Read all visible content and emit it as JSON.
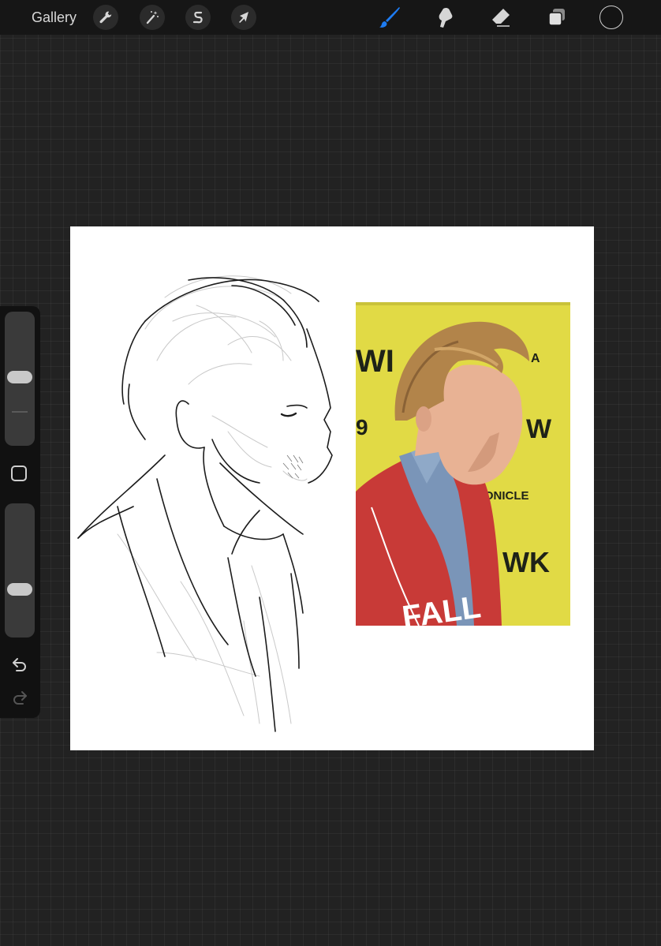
{
  "topbar": {
    "gallery_label": "Gallery",
    "left_tools": [
      {
        "name": "actions",
        "icon": "wrench-icon"
      },
      {
        "name": "adjustments",
        "icon": "magic-wand-icon"
      },
      {
        "name": "selection",
        "icon": "selection-s-icon"
      },
      {
        "name": "transform",
        "icon": "arrow-cursor-icon"
      }
    ],
    "right_tools": [
      {
        "name": "brush",
        "icon": "brush-icon",
        "active": true
      },
      {
        "name": "smudge",
        "icon": "smudge-icon",
        "active": false
      },
      {
        "name": "eraser",
        "icon": "eraser-icon",
        "active": false
      },
      {
        "name": "layers",
        "icon": "layers-icon",
        "active": false
      }
    ],
    "current_color": "#141414",
    "accent_color": "#1e7cf2"
  },
  "sidebar": {
    "brush_size_level": 0.5,
    "opacity_level": 0.35,
    "icons": [
      "undo-icon",
      "redo-icon"
    ]
  },
  "canvas": {
    "background": "#ffffff",
    "reference_photo": {
      "wall_color": "#e1da45",
      "jacket_color": "#c83a37",
      "wall_text": [
        "WI",
        "A",
        "9",
        "W",
        "RONICLE",
        "WK"
      ],
      "jacket_text": "FALL"
    }
  }
}
